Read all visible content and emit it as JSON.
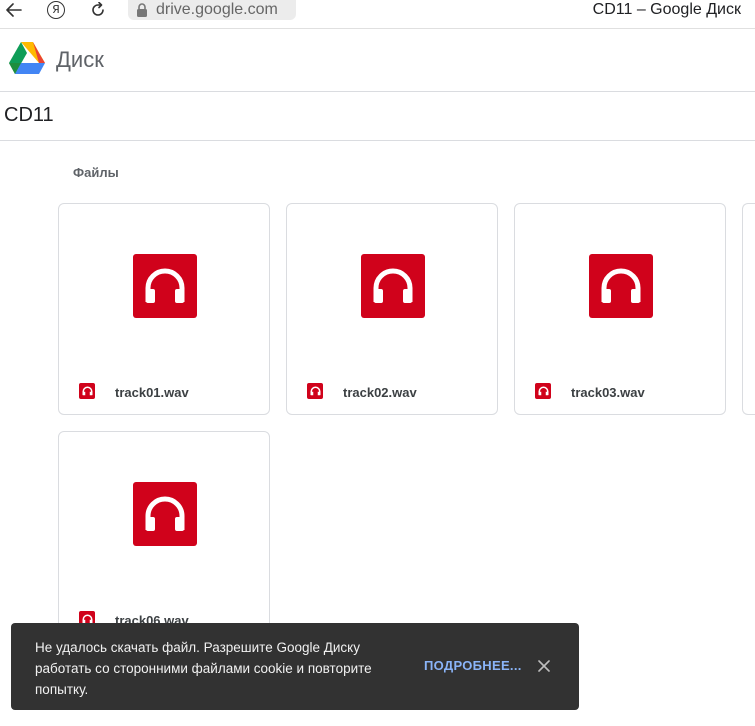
{
  "browser": {
    "url": "drive.google.com",
    "window_title": "CD11 – Google Диск",
    "ya_label": "Я"
  },
  "app": {
    "name": "Диск"
  },
  "folder": {
    "title": "CD11",
    "section_label": "Файлы"
  },
  "files": [
    {
      "name": "track01.wav",
      "icon": "headphones-icon"
    },
    {
      "name": "track02.wav",
      "icon": "headphones-icon"
    },
    {
      "name": "track03.wav",
      "icon": "headphones-icon"
    },
    {
      "name": "track06.wav",
      "icon": "headphones-icon"
    }
  ],
  "toast": {
    "message": "Не удалось скачать файл. Разрешите Google Диску работать со сторонними файлами cookie и повторите попытку.",
    "action": "ПОДРОБНЕЕ..."
  },
  "colors": {
    "audio_icon": "#d0021b",
    "toast_bg": "#323232",
    "toast_action": "#8ab4f8"
  }
}
